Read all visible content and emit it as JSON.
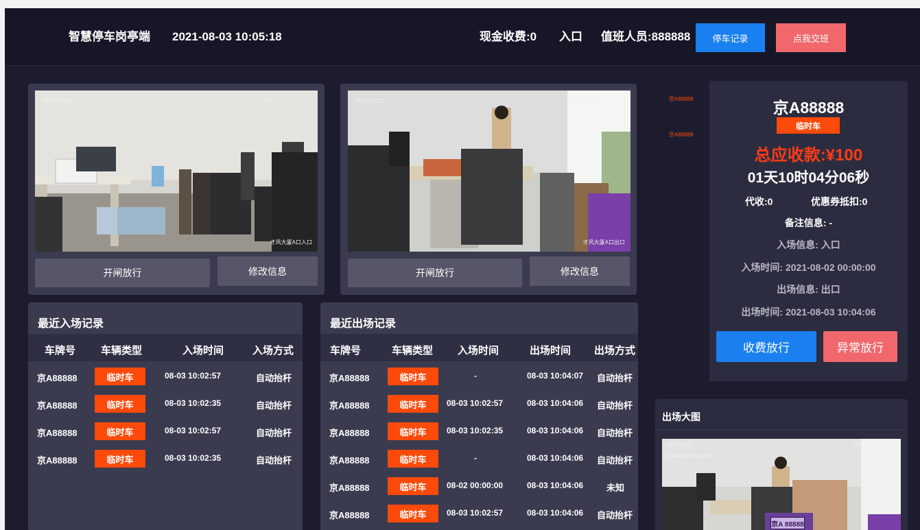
{
  "header": {
    "app_title": "智慧停车岗亭端",
    "datetime": "2021-08-03 10:05:18",
    "cash_fee": "现金收费:0",
    "gate": "入口",
    "staff": "值班人员:888888",
    "records_button": "停车记录",
    "handover_button": "点我交班"
  },
  "cameras": [
    {
      "date_overlay": "08/03/2021",
      "time_overlay": "10:05:20",
      "location_overlay": "才风大厦A口入口",
      "open_button": "开闸放行",
      "edit_button": "修改信息"
    },
    {
      "date_overlay": "08/03/2021",
      "time_overlay": "10:05:19",
      "location_overlay": "才风大厦A口出口",
      "open_button": "开闸放行",
      "edit_button": "修改信息"
    }
  ],
  "entry_records": {
    "title": "最近入场记录",
    "columns": [
      "车牌号",
      "车辆类型",
      "入场时间",
      "入场方式"
    ],
    "rows": [
      {
        "plate": "京A88888",
        "type": "临时车",
        "entry_time": "08-03 10:02:57",
        "method": "自动抬杆"
      },
      {
        "plate": "京A88888",
        "type": "临时车",
        "entry_time": "08-03 10:02:35",
        "method": "自动抬杆"
      },
      {
        "plate": "京A88888",
        "type": "临时车",
        "entry_time": "08-03 10:02:57",
        "method": "自动抬杆"
      },
      {
        "plate": "京A88888",
        "type": "临时车",
        "entry_time": "08-03 10:02:35",
        "method": "自动抬杆"
      }
    ]
  },
  "exit_records": {
    "title": "最近出场记录",
    "columns": [
      "车牌号",
      "车辆类型",
      "入场时间",
      "出场时间",
      "出场方式"
    ],
    "rows": [
      {
        "plate": "京A88888",
        "type": "临时车",
        "entry_time": "-",
        "exit_time": "08-03 10:04:07",
        "method": "自动抬杆"
      },
      {
        "plate": "京A88888",
        "type": "临时车",
        "entry_time": "08-03 10:02:57",
        "exit_time": "08-03 10:04:06",
        "method": "自动抬杆"
      },
      {
        "plate": "京A88888",
        "type": "临时车",
        "entry_time": "08-03 10:02:35",
        "exit_time": "08-03 10:04:06",
        "method": "自动抬杆"
      },
      {
        "plate": "京A88888",
        "type": "临时车",
        "entry_time": "-",
        "exit_time": "08-03 10:04:06",
        "method": "自动抬杆"
      },
      {
        "plate": "京A88888",
        "type": "临时车",
        "entry_time": "08-02 00:00:00",
        "exit_time": "08-03 10:04:06",
        "method": "未知"
      },
      {
        "plate": "京A88888",
        "type": "临时车",
        "entry_time": "08-03 10:02:57",
        "exit_time": "08-03 10:04:06",
        "method": "自动抬杆"
      }
    ]
  },
  "vehicle_info": {
    "side_list": [
      "京A88888",
      "京A88888"
    ],
    "plate": "京A88888",
    "type_badge": "临时车",
    "total_due": "总应收款:¥100",
    "duration": "01天10时04分06秒",
    "collected": "代收:0",
    "coupon": "优惠券抵扣:0",
    "remark": "备注信息: -",
    "entry_info": "入场信息: 入口",
    "entry_time": "入场时间: 2021-08-02 00:00:00",
    "exit_info": "出场信息: 出口",
    "exit_time": "出场时间: 2021-08-03 10:04:06",
    "charge_button": "收费放行",
    "abnormal_button": "异常放行"
  },
  "exit_big_image": {
    "title": "出场大图",
    "date_overlay": "08/03/2021",
    "time_overlay": "10:0",
    "plate_overlay": "京A88888 蓝牌 26%置信",
    "plate_display": "京A 88888"
  },
  "colors": {
    "accent_blue": "#1a80f0",
    "accent_red": "#f0686c",
    "tag_orange": "#fc4a0a",
    "total_red": "#ff3c14"
  }
}
